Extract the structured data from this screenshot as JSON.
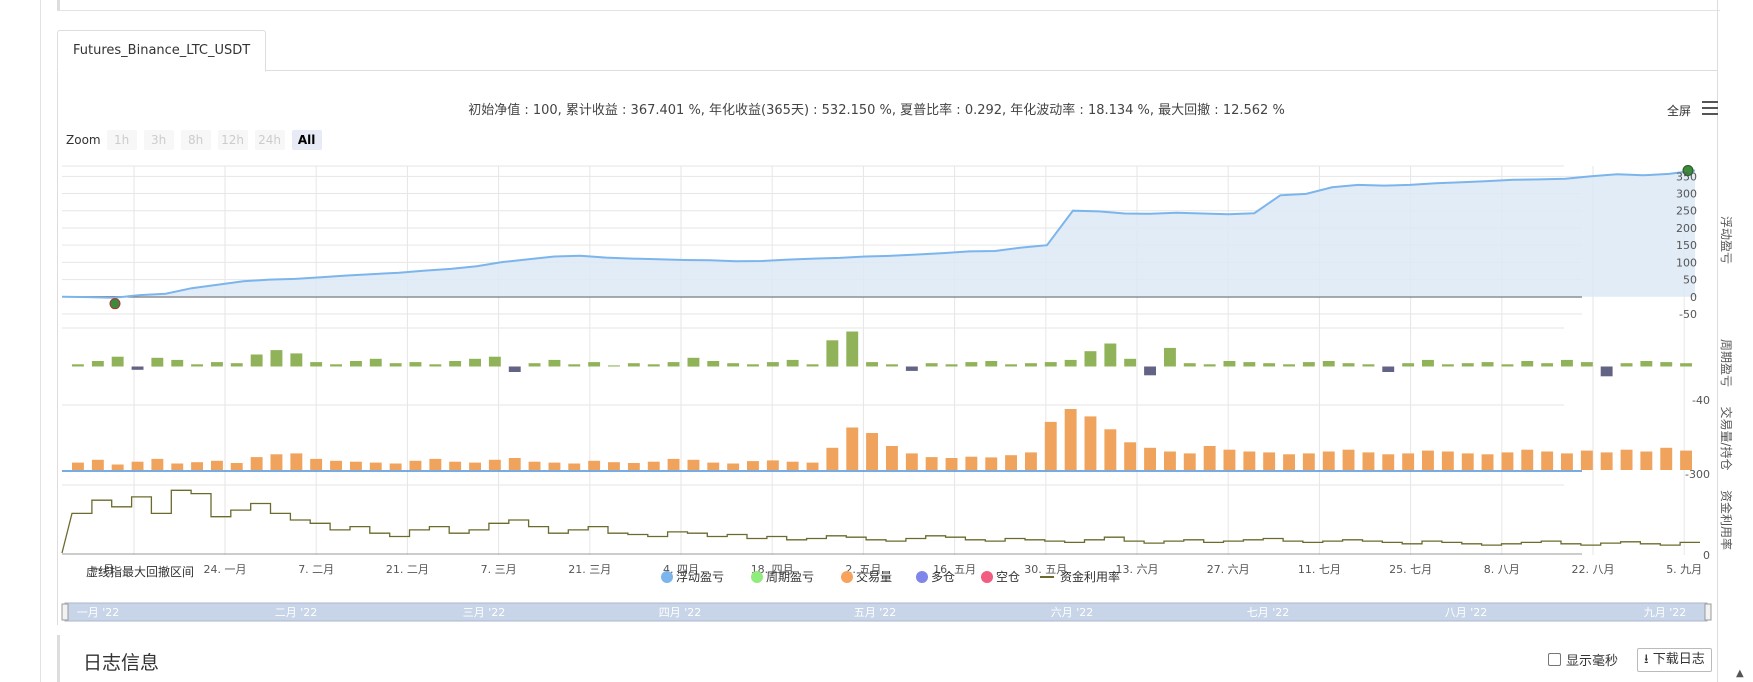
{
  "tab": {
    "label": "Futures_Binance_LTC_USDT"
  },
  "header": {
    "subtitle": "初始净值 : 100, 累计收益 : 367.401 %, 年化收益(365天) : 532.150 %, 夏普比率 : 0.292, 年化波动率 : 18.134 %, 最大回撤 : 12.562 %",
    "fullscreen_label": "全屏"
  },
  "zoom": {
    "label": "Zoom",
    "buttons": [
      "1h",
      "3h",
      "8h",
      "12h",
      "24h",
      "All"
    ],
    "active": "All"
  },
  "colors": {
    "pnl_line": "#7cb5ec",
    "pnl_fill": "#dde9f6",
    "period_pos": "#90b35a",
    "period_neg": "#636386",
    "volume": "#f0a35c",
    "utilization": "#6b6b2e",
    "legend_float": "#7cb5ec",
    "legend_period": "#90ed7d",
    "legend_volume": "#f7a35c",
    "legend_long": "#8085e9",
    "legend_short": "#f15c80",
    "marker": "#3d8a3d",
    "navigator": "#c8d5e8"
  },
  "chart_data": {
    "type": "line",
    "x_tick_labels": [
      "24. 一月",
      "7. 二月",
      "21. 二月",
      "7. 三月",
      "21. 三月",
      "4. 四月",
      "18. 四月",
      "2. 五月",
      "16. 五月",
      "30. 五月",
      "13. 六月",
      "27. 六月",
      "11. 七月",
      "25. 七月",
      "8. 八月",
      "22. 八月",
      "5. 九月"
    ],
    "overlay_x_labels": [
      "一月",
      "10. 一月"
    ],
    "navigator_labels": [
      "一月 '22",
      "二月 '22",
      "三月 '22",
      "四月 '22",
      "五月 '22",
      "六月 '22",
      "七月 '22",
      "八月 '22",
      "九月 '22"
    ],
    "annotation": "虚线指最大回撤区间",
    "panes": [
      {
        "name": "浮动盈亏",
        "y_ticks": [
          "-50",
          "0",
          "50",
          "100",
          "150",
          "200",
          "250",
          "300",
          "350"
        ],
        "ylim": [
          -50,
          380
        ],
        "series_name": "浮动盈亏",
        "values": [
          0,
          -1,
          -3,
          5,
          9,
          25,
          35,
          45,
          50,
          52,
          57,
          62,
          66,
          70,
          76,
          81,
          89,
          101,
          109,
          117,
          119,
          114,
          111,
          109,
          107,
          106,
          103,
          104,
          108,
          111,
          113,
          117,
          119,
          123,
          127,
          132,
          133,
          143,
          150,
          250,
          248,
          242,
          241,
          244,
          242,
          240,
          243,
          295,
          299,
          318,
          325,
          323,
          325,
          330,
          333,
          336,
          340,
          341,
          343,
          350,
          356,
          353,
          357,
          367
        ]
      },
      {
        "name": "周期盈亏",
        "y_ticks": [
          "-40"
        ],
        "series_name": "周期盈亏",
        "values": [
          2,
          5,
          9,
          -3,
          8,
          6,
          2,
          4,
          3,
          11,
          15,
          12,
          4,
          2,
          5,
          7,
          3,
          4,
          2,
          5,
          7,
          9,
          -5,
          3,
          6,
          2,
          4,
          1,
          3,
          2,
          4,
          8,
          5,
          3,
          2,
          4,
          6,
          2,
          24,
          32,
          4,
          2,
          -4,
          3,
          2,
          4,
          5,
          2,
          3,
          4,
          6,
          14,
          21,
          7,
          -8,
          17,
          3,
          2,
          5,
          4,
          3,
          2,
          4,
          5,
          3,
          2,
          -5,
          3,
          6,
          2,
          3,
          4,
          2,
          5,
          3,
          6,
          4,
          -9,
          3,
          5,
          4,
          3
        ]
      },
      {
        "name": "交易量/持仓",
        "y_ticks": [
          "-300"
        ],
        "series_name": "交易量",
        "values": [
          40,
          55,
          30,
          45,
          60,
          35,
          42,
          50,
          38,
          70,
          85,
          90,
          60,
          50,
          45,
          40,
          35,
          50,
          60,
          45,
          40,
          55,
          65,
          45,
          40,
          35,
          50,
          42,
          38,
          45,
          60,
          55,
          40,
          35,
          48,
          52,
          45,
          40,
          120,
          230,
          200,
          130,
          90,
          70,
          65,
          72,
          68,
          80,
          95,
          260,
          330,
          290,
          220,
          150,
          120,
          100,
          90,
          130,
          110,
          100,
          95,
          85,
          90,
          100,
          110,
          95,
          85,
          90,
          105,
          100,
          90,
          85,
          95,
          110,
          100,
          90,
          105,
          95,
          110,
          100,
          120,
          105
        ]
      },
      {
        "name": "资金利用率",
        "y_ticks": [
          "0"
        ],
        "series_name": "资金利用率",
        "values": [
          60,
          80,
          70,
          85,
          60,
          95,
          90,
          55,
          65,
          75,
          60,
          50,
          45,
          35,
          40,
          30,
          25,
          35,
          40,
          30,
          35,
          45,
          50,
          40,
          30,
          35,
          40,
          30,
          28,
          25,
          32,
          30,
          25,
          28,
          22,
          25,
          20,
          22,
          26,
          24,
          20,
          18,
          22,
          26,
          24,
          20,
          18,
          22,
          20,
          18,
          16,
          20,
          24,
          18,
          15,
          18,
          20,
          16,
          18,
          20,
          22,
          18,
          16,
          18,
          20,
          18,
          16,
          14,
          18,
          16,
          14,
          12,
          14,
          16,
          18,
          14,
          12,
          15,
          17,
          14,
          12,
          16
        ]
      }
    ],
    "legend": [
      "浮动盈亏",
      "周期盈亏",
      "交易量",
      "多仓",
      "空仓",
      "资金利用率"
    ]
  },
  "log": {
    "title": "日志信息",
    "ms_label": "显示毫秒",
    "download_label": "下载日志"
  }
}
